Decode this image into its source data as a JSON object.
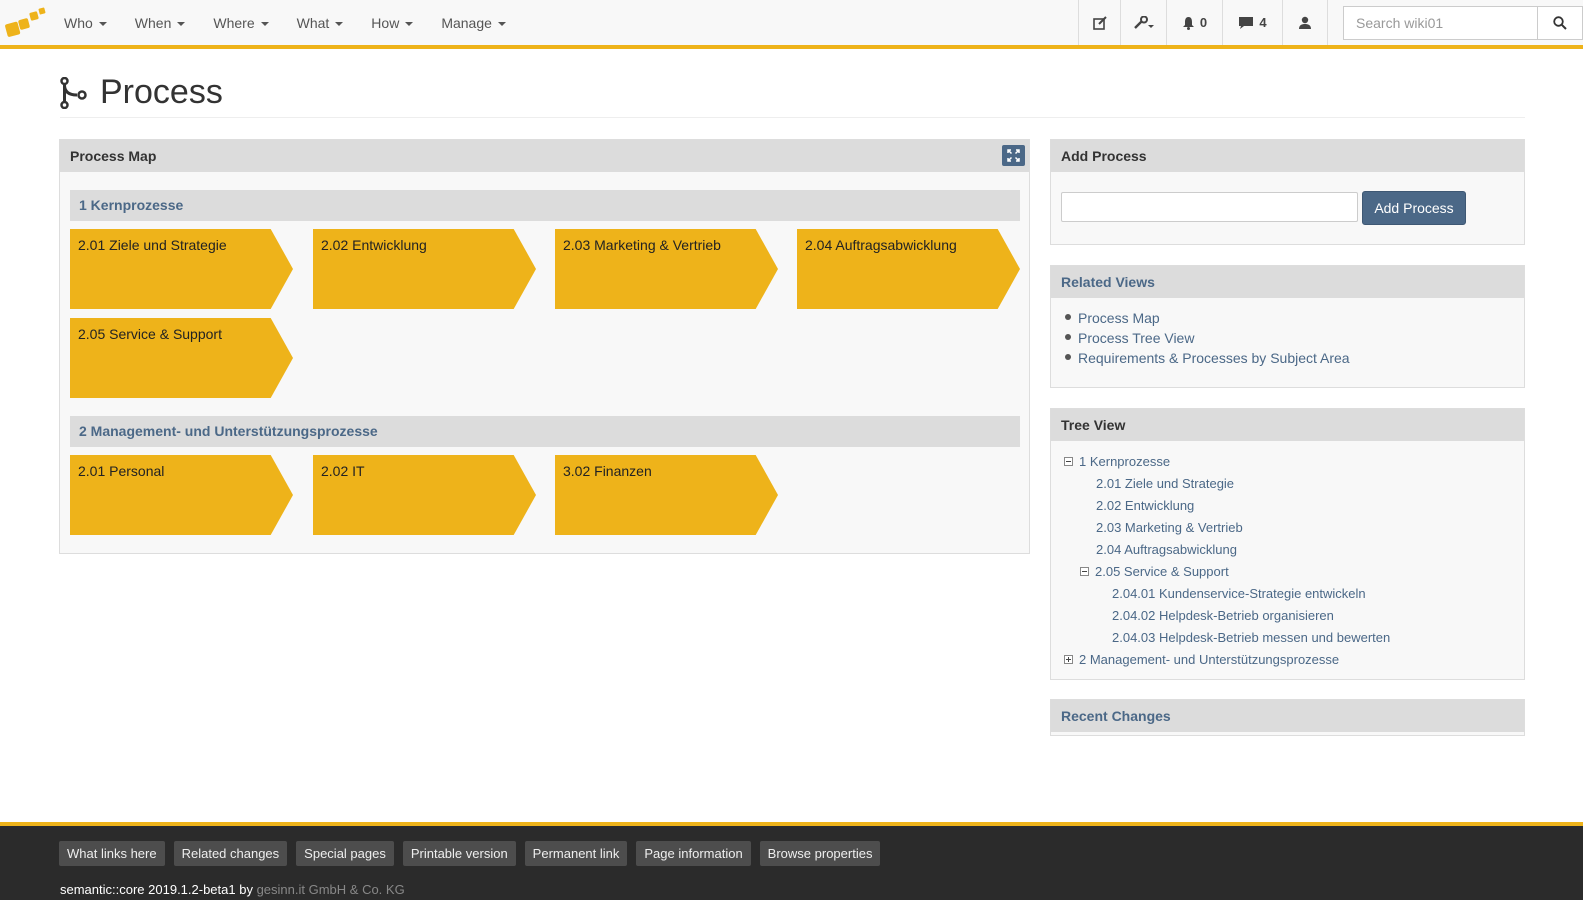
{
  "nav": {
    "menus": [
      "Who",
      "When",
      "Where",
      "What",
      "How",
      "Manage"
    ],
    "notifications_count": "0",
    "messages_count": "4",
    "search_placeholder": "Search wiki01"
  },
  "page": {
    "title": "Process"
  },
  "process_map": {
    "heading": "Process Map",
    "sections": [
      {
        "title": "1 Kernprozesse",
        "items": [
          "2.01 Ziele und Strategie",
          "2.02 Entwicklung",
          "2.03 Marketing & Vertrieb",
          "2.04 Auftragsabwicklung",
          "2.05 Service & Support"
        ]
      },
      {
        "title": "2 Management- und Unterstützungsprozesse",
        "items": [
          "2.01 Personal",
          "2.02 IT",
          "3.02 Finanzen"
        ]
      }
    ]
  },
  "add_process": {
    "heading": "Add Process",
    "input_value": "",
    "button_label": "Add Process"
  },
  "related_views": {
    "heading": "Related Views",
    "items": [
      "Process Map",
      "Process Tree View",
      "Requirements & Processes by Subject Area"
    ]
  },
  "tree_view": {
    "heading": "Tree View",
    "nodes": [
      {
        "label": "1 Kernprozesse",
        "level": 0,
        "toggle": "minus"
      },
      {
        "label": "2.01 Ziele und Strategie",
        "level": 1,
        "toggle": ""
      },
      {
        "label": "2.02 Entwicklung",
        "level": 1,
        "toggle": ""
      },
      {
        "label": "2.03 Marketing & Vertrieb",
        "level": 1,
        "toggle": ""
      },
      {
        "label": "2.04 Auftragsabwicklung",
        "level": 1,
        "toggle": ""
      },
      {
        "label": "2.05 Service & Support",
        "level": 1,
        "toggle": "minus"
      },
      {
        "label": "2.04.01 Kundenservice-Strategie entwickeln",
        "level": 2,
        "toggle": ""
      },
      {
        "label": "2.04.02 Helpdesk-Betrieb organisieren",
        "level": 2,
        "toggle": ""
      },
      {
        "label": "2.04.03 Helpdesk-Betrieb messen und bewerten",
        "level": 2,
        "toggle": ""
      },
      {
        "label": "2 Management- und Unterstützungsprozesse",
        "level": 0,
        "toggle": "plus"
      }
    ]
  },
  "recent_changes": {
    "heading": "Recent Changes"
  },
  "footer": {
    "links": [
      "What links here",
      "Related changes",
      "Special pages",
      "Printable version",
      "Permanent link",
      "Page information",
      "Browse properties"
    ],
    "credit_prefix": "semantic::core 2019.1.2-beta1 by",
    "credit_company": "gesinn.it GmbH & Co. KG"
  },
  "colors": {
    "accent": "#eeb31a",
    "link": "#4b6887",
    "panel_header": "#dcdcdc",
    "footer": "#2b2b2b"
  },
  "icons": [
    "logo-icon",
    "edit-icon",
    "wrench-icon",
    "bell-icon",
    "comment-icon",
    "user-icon",
    "search-icon",
    "process-icon",
    "expand-icon"
  ]
}
